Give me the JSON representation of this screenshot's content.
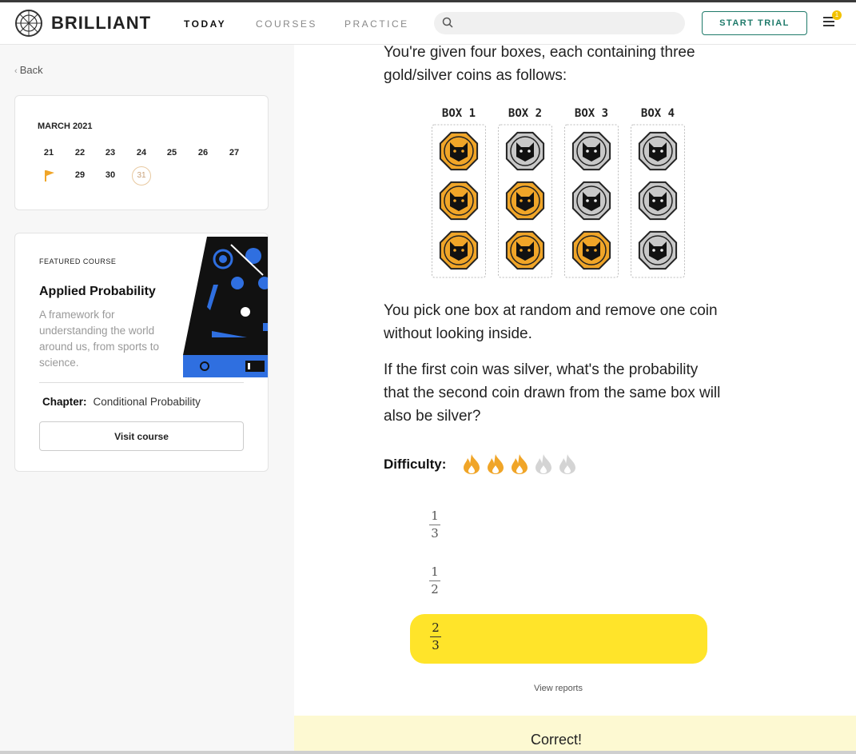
{
  "header": {
    "brand": "BRILLIANT",
    "nav": [
      "TODAY",
      "COURSES",
      "PRACTICE"
    ],
    "search_placeholder": "",
    "trial_label": "START TRIAL",
    "notification_count": "1"
  },
  "sidebar": {
    "back_label": "Back",
    "calendar": {
      "month": "MARCH 2021",
      "row1": [
        "21",
        "22",
        "23",
        "24",
        "25",
        "26",
        "27"
      ],
      "row2": [
        "29",
        "30"
      ],
      "today": "31"
    },
    "featured": {
      "label": "FEATURED  COURSE",
      "title": "Applied Probability",
      "description": "A framework for understanding the world around us, from sports to science.",
      "chapter_label": "Chapter:",
      "chapter_value": "Conditional Probability",
      "visit_label": "Visit course"
    }
  },
  "problem": {
    "intro": "You're given four boxes, each containing three gold/silver coins as follows:",
    "boxes": [
      {
        "label": "BOX  1",
        "coins": [
          "gold",
          "gold",
          "gold"
        ]
      },
      {
        "label": "BOX  2",
        "coins": [
          "silver",
          "gold",
          "gold"
        ]
      },
      {
        "label": "BOX  3",
        "coins": [
          "silver",
          "silver",
          "gold"
        ]
      },
      {
        "label": "BOX  4",
        "coins": [
          "silver",
          "silver",
          "silver"
        ]
      }
    ],
    "para2": "You pick one box at random and remove one coin without looking inside.",
    "para3": "If the first coin was silver, what's the probability that the second coin drawn from the same box will also be silver?",
    "difficulty_label": "Difficulty:",
    "difficulty_level": 3,
    "difficulty_max": 5,
    "options": [
      {
        "num": "1",
        "den": "3",
        "selected": false
      },
      {
        "num": "1",
        "den": "2",
        "selected": false
      },
      {
        "num": "2",
        "den": "3",
        "selected": true
      }
    ],
    "view_reports": "View reports",
    "result": "Correct!"
  },
  "colors": {
    "accent": "#1f7a6a",
    "gold_coin": "#f0a528",
    "silver_coin": "#c8c8c8",
    "selected_option": "#ffe42a",
    "result_banner": "#fdf9d2"
  }
}
